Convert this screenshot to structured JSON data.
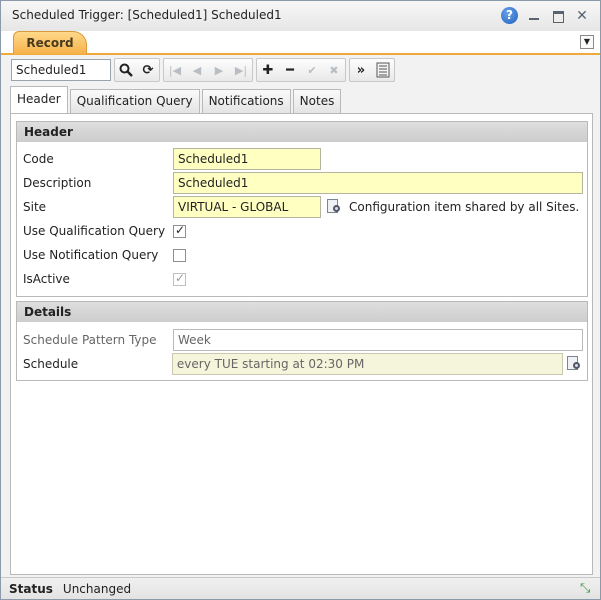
{
  "window": {
    "title": "Scheduled Trigger: [Scheduled1] Scheduled1"
  },
  "record_tab": {
    "label": "Record"
  },
  "toolbar": {
    "record_value": "Scheduled1"
  },
  "tabs": [
    {
      "label": "Header",
      "active": true
    },
    {
      "label": "Qualification Query",
      "active": false
    },
    {
      "label": "Notifications",
      "active": false
    },
    {
      "label": "Notes",
      "active": false
    }
  ],
  "header_section": {
    "title": "Header",
    "code": {
      "label": "Code",
      "value": "Scheduled1"
    },
    "description": {
      "label": "Description",
      "value": "Scheduled1"
    },
    "site": {
      "label": "Site",
      "value": "VIRTUAL - GLOBAL",
      "hint": "Configuration item shared by all Sites."
    },
    "use_qualification_query": {
      "label": "Use Qualification Query",
      "checked": true
    },
    "use_notification_query": {
      "label": "Use Notification Query",
      "checked": false
    },
    "is_active": {
      "label": "IsActive",
      "checked": true
    }
  },
  "details_section": {
    "title": "Details",
    "schedule_pattern_type": {
      "label": "Schedule Pattern Type",
      "value": "Week"
    },
    "schedule": {
      "label": "Schedule",
      "value": "every TUE starting at 02:30 PM"
    }
  },
  "status": {
    "label": "Status",
    "value": "Unchanged"
  }
}
